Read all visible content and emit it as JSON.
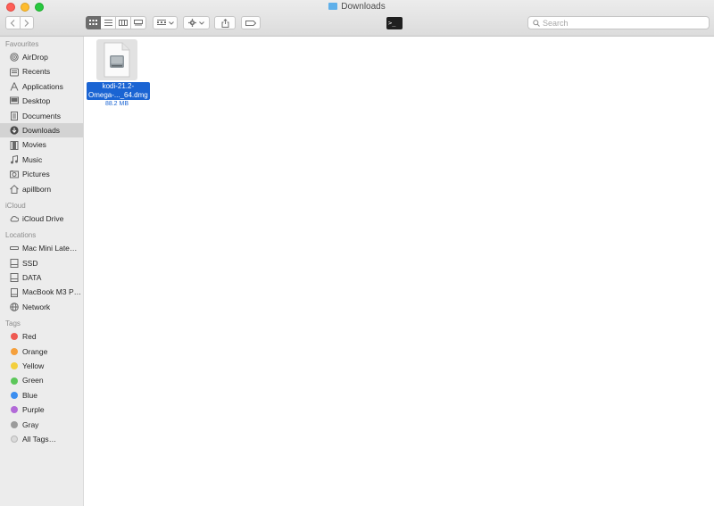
{
  "window": {
    "title": "Downloads"
  },
  "search": {
    "placeholder": "Search"
  },
  "sidebar": {
    "favourites_title": "Favourites",
    "favourites": [
      {
        "label": "AirDrop",
        "icon": "airdrop-icon"
      },
      {
        "label": "Recents",
        "icon": "recents-icon"
      },
      {
        "label": "Applications",
        "icon": "applications-icon"
      },
      {
        "label": "Desktop",
        "icon": "desktop-icon"
      },
      {
        "label": "Documents",
        "icon": "documents-icon"
      },
      {
        "label": "Downloads",
        "icon": "downloads-icon"
      },
      {
        "label": "Movies",
        "icon": "movies-icon"
      },
      {
        "label": "Music",
        "icon": "music-icon"
      },
      {
        "label": "Pictures",
        "icon": "pictures-icon"
      },
      {
        "label": "apillborn",
        "icon": "home-icon"
      }
    ],
    "icloud_title": "iCloud",
    "icloud": [
      {
        "label": "iCloud Drive",
        "icon": "cloud-icon"
      }
    ],
    "locations_title": "Locations",
    "locations": [
      {
        "label": "Mac Mini Late…",
        "icon": "computer-icon"
      },
      {
        "label": "SSD",
        "icon": "disk-icon"
      },
      {
        "label": "DATA",
        "icon": "disk-icon"
      },
      {
        "label": "MacBook M3 P…",
        "icon": "disk-icon"
      },
      {
        "label": "Network",
        "icon": "network-icon"
      }
    ],
    "tags_title": "Tags",
    "tags": [
      {
        "label": "Red",
        "color": "#ee5a52"
      },
      {
        "label": "Orange",
        "color": "#f5a03c"
      },
      {
        "label": "Yellow",
        "color": "#f3cf3d"
      },
      {
        "label": "Green",
        "color": "#5cc75a"
      },
      {
        "label": "Blue",
        "color": "#3b8ef0"
      },
      {
        "label": "Purple",
        "color": "#b26ad8"
      },
      {
        "label": "Gray",
        "color": "#9b9b9b"
      },
      {
        "label": "All Tags…",
        "color": ""
      }
    ]
  },
  "files": [
    {
      "name_line1": "kodi-21.2-",
      "name_line2": "Omega-..._64.dmg",
      "size": "88.2 MB"
    }
  ],
  "colors": {
    "selection": "#1a64d3",
    "sidebar_bg": "#ececec"
  }
}
